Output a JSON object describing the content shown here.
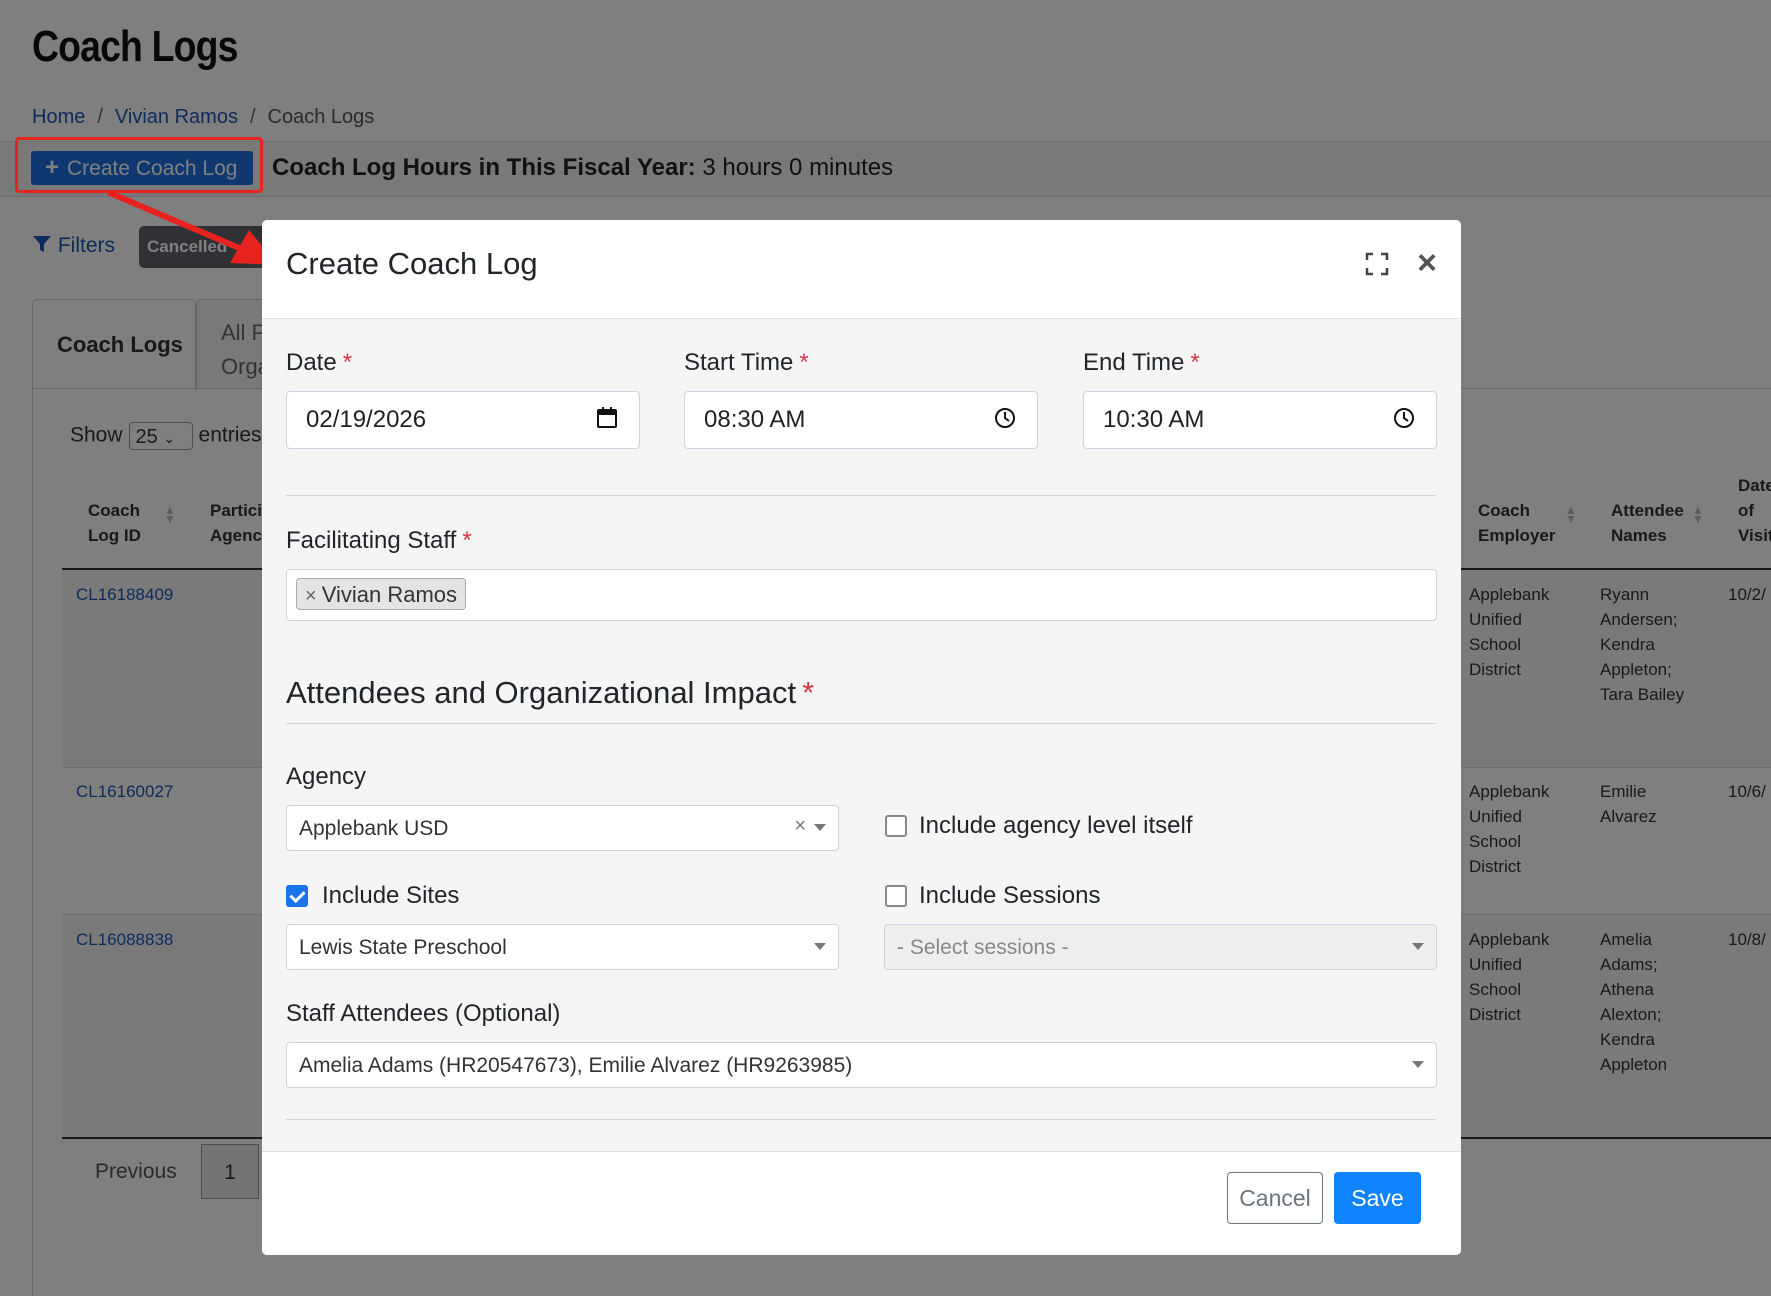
{
  "page": {
    "title": "Coach Logs",
    "breadcrumb": [
      "Home",
      "Vivian Ramos",
      "Coach Logs"
    ],
    "create_button_label": "Create Coach Log",
    "hours_label": "Coach Log Hours in This Fiscal Year:",
    "hours_value": "3 hours 0 minutes",
    "filters_label": "Filters",
    "cancelled_chip": "Cancelled",
    "tabs": [
      {
        "label": "Coach Logs"
      },
      {
        "label": "All P"
      },
      {
        "label": "Orga"
      }
    ],
    "show_label": "Show",
    "show_value": "25",
    "entries_label": "entries",
    "pager_prev": "Previous",
    "pager_page": "1"
  },
  "table": {
    "headers": {
      "coach_log_id_1": "Coach",
      "coach_log_id_2": "Log ID",
      "participating_1": "Partici",
      "participating_2": "Agenc",
      "coach_employer_1": "Coach",
      "coach_employer_2": "Employer",
      "attendee_names_1": "Attendee",
      "attendee_names_2": "Names",
      "date_of_visit_1": "Date",
      "date_of_visit_2": "of",
      "date_of_visit_3": "Visit"
    },
    "rows": [
      {
        "id": "CL16188409",
        "employer": [
          "Applebank",
          "Unified",
          "School",
          "District"
        ],
        "attendees": [
          "Ryann",
          "Andersen;",
          "Kendra",
          "Appleton;",
          "Tara Bailey"
        ],
        "date": "10/2/"
      },
      {
        "id": "CL16160027",
        "employer": [
          "Applebank",
          "Unified",
          "School",
          "District"
        ],
        "attendees": [
          "Emilie",
          "Alvarez"
        ],
        "date": "10/6/"
      },
      {
        "id": "CL16088838",
        "employer": [
          "Applebank",
          "Unified",
          "School",
          "District"
        ],
        "attendees": [
          "Amelia",
          "Adams;",
          "Athena",
          "Alexton;",
          "Kendra",
          "Appleton"
        ],
        "date": "10/8/"
      }
    ]
  },
  "modal": {
    "title": "Create Coach Log",
    "date_label": "Date",
    "date_value": "02/19/2026",
    "start_time_label": "Start Time",
    "start_time_value": "08:30 AM",
    "end_time_label": "End Time",
    "end_time_value": "10:30 AM",
    "required_marker": "*",
    "facilitating_staff_label": "Facilitating Staff",
    "facilitating_staff_tags": [
      "Vivian Ramos"
    ],
    "tag_remove": "×",
    "attendees_section_title": "Attendees and Organizational Impact",
    "agency_label": "Agency",
    "agency_value": "Applebank USD",
    "include_agency_label": "Include agency level itself",
    "include_agency_checked": false,
    "include_sites_label": "Include Sites",
    "include_sites_checked": true,
    "include_sessions_label": "Include Sessions",
    "include_sessions_checked": false,
    "sites_value": "Lewis State Preschool",
    "sessions_placeholder": "- Select sessions -",
    "staff_attendees_label": "Staff Attendees (Optional)",
    "staff_attendees_value": "Amelia Adams (HR20547673), Emilie Alvarez (HR9263985)",
    "cancel_label": "Cancel",
    "save_label": "Save"
  },
  "colors": {
    "primary": "#1084ff",
    "link": "#1a57b8",
    "required": "#dc3545",
    "highlight": "#e8231f"
  }
}
